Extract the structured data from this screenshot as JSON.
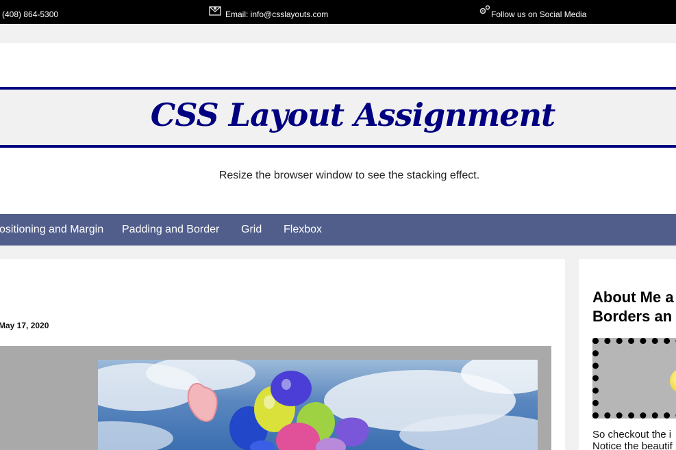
{
  "topbar": {
    "phone": "(408) 864-5300",
    "email": "Email: info@csslayouts.com",
    "social": "Follow us on Social Media"
  },
  "header": {
    "title": "CSS Layout Assignment",
    "subtitle": "Resize the browser window to see the stacking effect."
  },
  "nav": {
    "items": [
      {
        "label": "ositioning and Margin"
      },
      {
        "label": "Padding and Border"
      },
      {
        "label": "Grid"
      },
      {
        "label": "Flexbox"
      }
    ]
  },
  "main": {
    "date": "May 17, 2020"
  },
  "sidebar": {
    "heading_line1": "About Me a",
    "heading_line2": "Borders an",
    "text_line1": "So checkout the i",
    "text_line2": "Notice the beautif"
  },
  "colors": {
    "title": "#000080",
    "nav_bg": "#515e8c",
    "topbar_bg": "#000000",
    "page_bg": "#f1f1f1"
  },
  "icons": {
    "email": "envelope-icon",
    "social": "gears-icon"
  }
}
